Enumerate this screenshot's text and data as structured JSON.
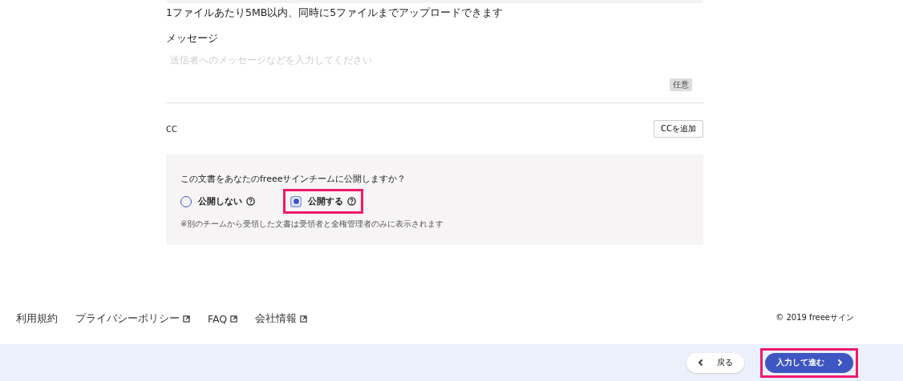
{
  "upload_note": "1ファイルあたり5MB以内、同時に5ファイルまでアップロードできます",
  "message": {
    "label": "メッセージ",
    "placeholder": "送信者へのメッセージなどを入力してください",
    "badge": "任意"
  },
  "cc": {
    "label": "CC",
    "button": "CCを追加"
  },
  "publish": {
    "question": "この文書をあなたのfreeeサインチームに公開しますか？",
    "options": [
      {
        "label": "公開しない",
        "selected": false,
        "highlighted": false
      },
      {
        "label": "公開する",
        "selected": true,
        "highlighted": true
      }
    ],
    "note": "※別のチームから受領した文書は受領者と全権管理者のみに表示されます"
  },
  "footer": {
    "links": [
      {
        "label": "利用規約",
        "external": false
      },
      {
        "label": "プライバシーポリシー",
        "external": true
      },
      {
        "label": "FAQ",
        "external": true
      },
      {
        "label": "会社情報",
        "external": true
      }
    ],
    "copyright": "© 2019 freeeサイン"
  },
  "actions": {
    "back": {
      "label": "戻る",
      "highlighted": false
    },
    "next": {
      "label": "入力して進む",
      "highlighted": true
    }
  }
}
